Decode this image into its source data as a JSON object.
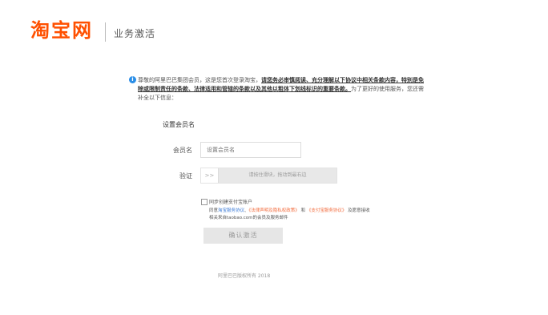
{
  "header": {
    "logo_text": "淘宝网",
    "subtitle": "业务激活"
  },
  "notice": {
    "intro": "尊敬的阿里巴巴集团会员，这是您首次登录淘宝，",
    "strong": "请您务必审慎阅读、充分理解以下协议中相关条款内容，特别是免除或限制责任的条款、法律适用和管辖的条款以及其他以粗体下划线标识的重要条款。",
    "tail": "为了更好的使用服务，您还需补全以下信息：",
    "icon_name": "info-icon",
    "icon_color": "#2a8ee7"
  },
  "form": {
    "section_title": "设置会员名",
    "member_label": "会员名",
    "member_placeholder": "设置会员名",
    "verify_label": "验证",
    "slider_handle": ">>",
    "slider_text": "请按住滑块，拖动到最右边",
    "sync_alipay": "同步创建支付宝账户",
    "agree_prefix": "同意",
    "link_1": "淘宝服务协议",
    "sep_1": "、",
    "link_2": "《法律声明及隐私权政策》",
    "and": "和",
    "link_3": "《支付宝服务协议》",
    "agree_suffix": "及愿意接收",
    "agree_line3": "相关来自taobao.com的会员及服务邮件",
    "confirm_button": "确认激活"
  },
  "footer": {
    "copyright": "阿里巴巴版权所有 2018"
  },
  "colors": {
    "brand": "#ff5000",
    "link_blue": "#3c7bd6",
    "link_red": "#f26a3b"
  }
}
